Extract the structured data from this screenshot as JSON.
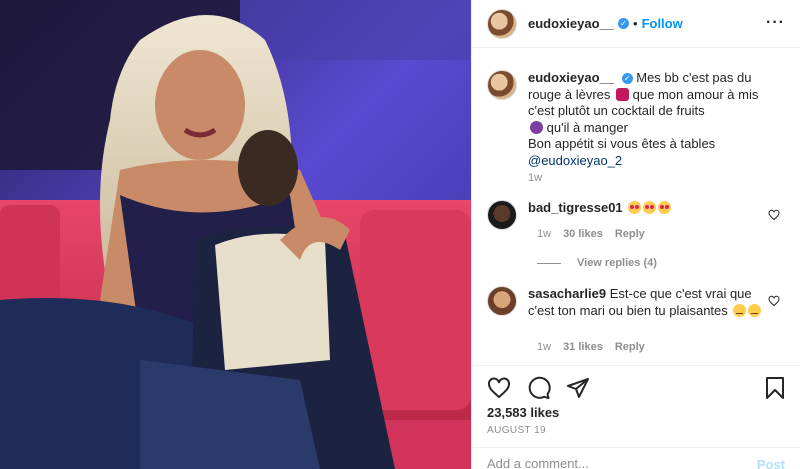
{
  "post": {
    "username": "eudoxieyao__",
    "follow_label": "Follow",
    "dot": "•",
    "more": "···",
    "verified_mark": "✓"
  },
  "caption": {
    "username": "eudoxieyao__",
    "line1": "Mes bb c'est pas du rouge à lèvres",
    "line1b": "que mon amour à mis c'est plutôt un cocktail de fruits",
    "line1c": "qu'il à manger",
    "line2": "Bon appétit si vous êtes à tables",
    "mention": "@eudoxieyao_2",
    "time": "1w"
  },
  "comments": [
    {
      "username": "bad_tigresse01",
      "text": "",
      "time": "1w",
      "likes": "30 likes",
      "reply_label": "Reply",
      "view_replies": "View replies (4)"
    },
    {
      "username": "sasacharlie9",
      "text": "Est-ce que c'est vrai que c'est ton mari ou bien tu plaisantes",
      "time": "1w",
      "likes": "31 likes",
      "reply_label": "Reply"
    }
  ],
  "actions": {
    "likes": "23,583 likes",
    "date": "AUGUST 19",
    "icons": [
      "heart-icon",
      "comment-icon",
      "share-icon",
      "bookmark-icon"
    ]
  },
  "add_comment": {
    "placeholder": "Add a comment...",
    "post_label": "Post"
  },
  "colors": {
    "link": "#0095f6",
    "muted": "#8e8e8e",
    "verified": "#3897f0"
  }
}
